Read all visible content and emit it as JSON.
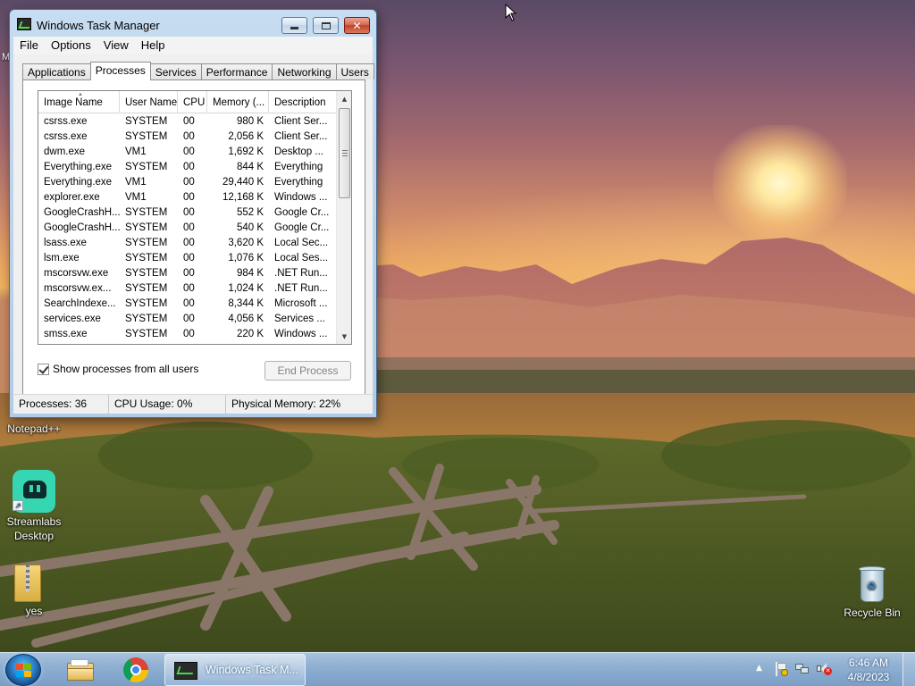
{
  "desktop": {
    "icons": [
      {
        "label": "Notepad++"
      },
      {
        "label": "Streamlabs\nDesktop"
      },
      {
        "label": "yes"
      },
      {
        "label": "Recycle Bin"
      }
    ],
    "partial_label": "M"
  },
  "task_manager": {
    "title": "Windows Task Manager",
    "menu": [
      "File",
      "Options",
      "View",
      "Help"
    ],
    "tabs": [
      "Applications",
      "Processes",
      "Services",
      "Performance",
      "Networking",
      "Users"
    ],
    "active_tab": "Processes",
    "columns": [
      "Image Name",
      "User Name",
      "CPU",
      "Memory (...",
      "Description"
    ],
    "rows": [
      [
        "csrss.exe",
        "SYSTEM",
        "00",
        "980 K",
        "Client Ser..."
      ],
      [
        "csrss.exe",
        "SYSTEM",
        "00",
        "2,056 K",
        "Client Ser..."
      ],
      [
        "dwm.exe",
        "VM1",
        "00",
        "1,692 K",
        "Desktop ..."
      ],
      [
        "Everything.exe",
        "SYSTEM",
        "00",
        "844 K",
        "Everything"
      ],
      [
        "Everything.exe",
        "VM1",
        "00",
        "29,440 K",
        "Everything"
      ],
      [
        "explorer.exe",
        "VM1",
        "00",
        "12,168 K",
        "Windows ..."
      ],
      [
        "GoogleCrashH...",
        "SYSTEM",
        "00",
        "552 K",
        "Google Cr..."
      ],
      [
        "GoogleCrashH...",
        "SYSTEM",
        "00",
        "540 K",
        "Google Cr..."
      ],
      [
        "lsass.exe",
        "SYSTEM",
        "00",
        "3,620 K",
        "Local Sec..."
      ],
      [
        "lsm.exe",
        "SYSTEM",
        "00",
        "1,076 K",
        "Local Ses..."
      ],
      [
        "mscorsvw.exe",
        "SYSTEM",
        "00",
        "984 K",
        ".NET Run..."
      ],
      [
        "mscorsvw.ex...",
        "SYSTEM",
        "00",
        "1,024 K",
        ".NET Run..."
      ],
      [
        "SearchIndexe...",
        "SYSTEM",
        "00",
        "8,344 K",
        "Microsoft ..."
      ],
      [
        "services.exe",
        "SYSTEM",
        "00",
        "4,056 K",
        "Services ..."
      ],
      [
        "smss.exe",
        "SYSTEM",
        "00",
        "220 K",
        "Windows ..."
      ]
    ],
    "show_all_label": "Show processes from all users",
    "show_all_checked": true,
    "end_process_label": "End Process",
    "status": {
      "processes": "Processes: 36",
      "cpu": "CPU Usage: 0%",
      "memory": "Physical Memory: 22%"
    }
  },
  "taskbar": {
    "pinned": [
      "windows-explorer-icon",
      "chrome-icon"
    ],
    "active_task": "Windows Task M...",
    "clock_time": "6:46 AM",
    "clock_date": "4/8/2023"
  }
}
